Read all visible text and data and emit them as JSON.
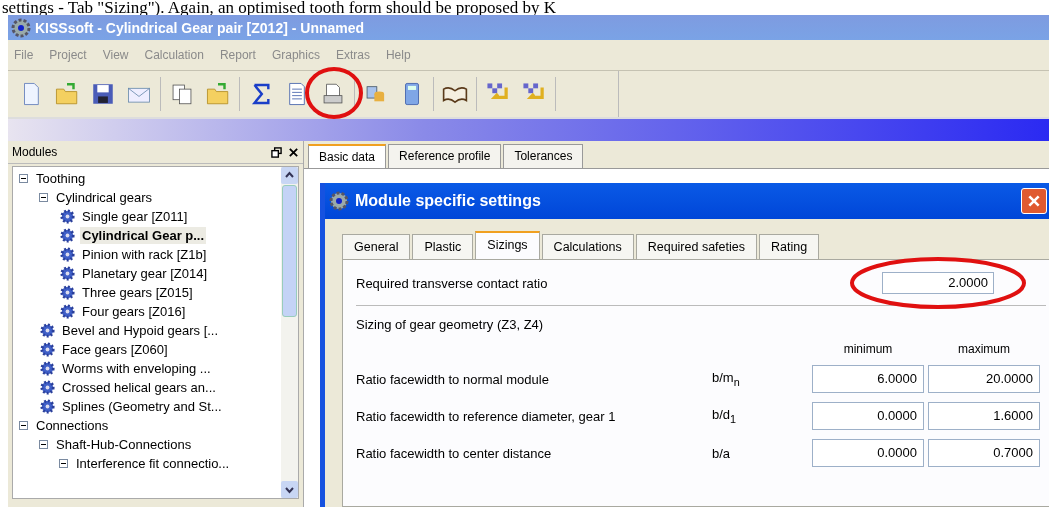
{
  "document_text": "settings - Tab \"Sizing\"). Again, an optimised tooth form should be proposed by K",
  "window": {
    "title": "KISSsoft - Cylindrical Gear pair [Z012] - Unnamed"
  },
  "menu": [
    "File",
    "Project",
    "View",
    "Calculation",
    "Report",
    "Graphics",
    "Extras",
    "Help"
  ],
  "toolbar": [
    {
      "buttons": [
        {
          "circled": false
        },
        {
          "circled": false
        },
        {
          "circled": false
        },
        {
          "circled": false
        }
      ]
    },
    {
      "buttons": [
        {
          "circled": false
        },
        {
          "circled": false
        }
      ]
    },
    {
      "buttons": [
        {
          "circled": false
        },
        {
          "circled": false
        },
        {
          "circled": true
        }
      ]
    },
    {
      "buttons": [
        {
          "circled": false
        },
        {
          "circled": false
        }
      ]
    },
    {
      "buttons": [
        {
          "circled": false
        }
      ]
    },
    {
      "buttons": [
        {
          "circled": false
        },
        {
          "circled": false
        }
      ]
    }
  ],
  "modules_panel": {
    "title": "Modules",
    "tree": [
      {
        "label": "Toothing",
        "expanded": true,
        "children": [
          {
            "label": "Cylindrical gears",
            "expanded": true,
            "children": [
              {
                "label": "Single gear [Z011]",
                "selected": false
              },
              {
                "label": "Cylindrical Gear p...",
                "selected": true
              },
              {
                "label": "Pinion with rack [Z1b]",
                "selected": false
              },
              {
                "label": "Planetary gear [Z014]",
                "selected": false
              },
              {
                "label": "Three gears [Z015]",
                "selected": false
              },
              {
                "label": "Four gears [Z016]",
                "selected": false
              }
            ]
          },
          {
            "label": "Bevel and Hypoid gears [...",
            "selected": false
          },
          {
            "label": "Face gears [Z060]",
            "selected": false
          },
          {
            "label": "Worms with enveloping ...",
            "selected": false
          },
          {
            "label": "Crossed helical gears an...",
            "selected": false
          },
          {
            "label": "Splines (Geometry and St...",
            "selected": false
          }
        ]
      },
      {
        "label": "Connections",
        "expanded": true,
        "children": [
          {
            "label": "Shaft-Hub-Connections",
            "expanded": true,
            "children": [
              {
                "label": "Interference fit connectio...",
                "expanded": true
              }
            ]
          }
        ]
      }
    ]
  },
  "main_tabs": [
    {
      "label": "Basic data",
      "selected": true
    },
    {
      "label": "Reference profile",
      "selected": false
    },
    {
      "label": "Tolerances",
      "selected": false
    }
  ],
  "dialog": {
    "title": "Module specific settings",
    "tabs": [
      {
        "label": "General",
        "selected": false
      },
      {
        "label": "Plastic",
        "selected": false
      },
      {
        "label": "Sizings",
        "selected": true
      },
      {
        "label": "Calculations",
        "selected": false
      },
      {
        "label": "Required safeties",
        "selected": false
      },
      {
        "label": "Rating",
        "selected": false
      }
    ],
    "contact_ratio": {
      "label": "Required transverse contact ratio",
      "value": "2.0000",
      "circled": true
    },
    "section_title": "Sizing of gear geometry (Z3, Z4)",
    "columns": [
      "minimum",
      "maximum"
    ],
    "rows": [
      {
        "label": "Ratio facewidth to normal module",
        "symbol": "b/m$_{n}$",
        "minimum": "6.0000",
        "maximum": "20.0000"
      },
      {
        "label": "Ratio facewidth to reference diameter, gear 1",
        "symbol": "b/d$_{1}$",
        "minimum": "0.0000",
        "maximum": "1.6000"
      },
      {
        "label": "Ratio facewidth to center distance",
        "symbol": "b/a",
        "minimum": "0.0000",
        "maximum": "0.7000"
      }
    ]
  }
}
